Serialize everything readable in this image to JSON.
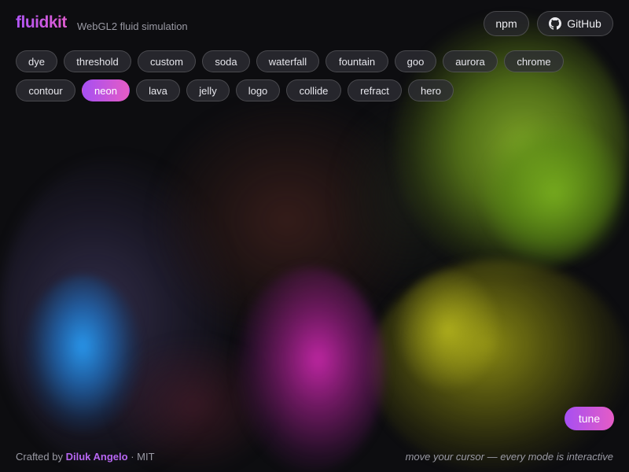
{
  "header": {
    "logo": "fluidkit",
    "subtitle": "WebGL2 fluid simulation",
    "npm_label": "npm",
    "github_label": "GitHub"
  },
  "modes": [
    {
      "label": "dye",
      "active": false
    },
    {
      "label": "threshold",
      "active": false
    },
    {
      "label": "custom",
      "active": false
    },
    {
      "label": "soda",
      "active": false
    },
    {
      "label": "waterfall",
      "active": false
    },
    {
      "label": "fountain",
      "active": false
    },
    {
      "label": "goo",
      "active": false
    },
    {
      "label": "aurora",
      "active": false
    },
    {
      "label": "chrome",
      "active": false
    },
    {
      "label": "contour",
      "active": false
    },
    {
      "label": "neon",
      "active": true
    },
    {
      "label": "lava",
      "active": false
    },
    {
      "label": "jelly",
      "active": false
    },
    {
      "label": "logo",
      "active": false
    },
    {
      "label": "collide",
      "active": false
    },
    {
      "label": "refract",
      "active": false
    },
    {
      "label": "hero",
      "active": false
    }
  ],
  "tune_label": "tune",
  "footer": {
    "prefix": "Crafted by",
    "author": "Diluk Angelo",
    "license": "· MIT",
    "hint": "move your cursor — every mode is interactive"
  },
  "colors": {
    "accent_start": "#a64ff2",
    "accent_end": "#e55cc6",
    "background": "#0b0b0e"
  },
  "icons": {
    "github": "github-icon"
  }
}
